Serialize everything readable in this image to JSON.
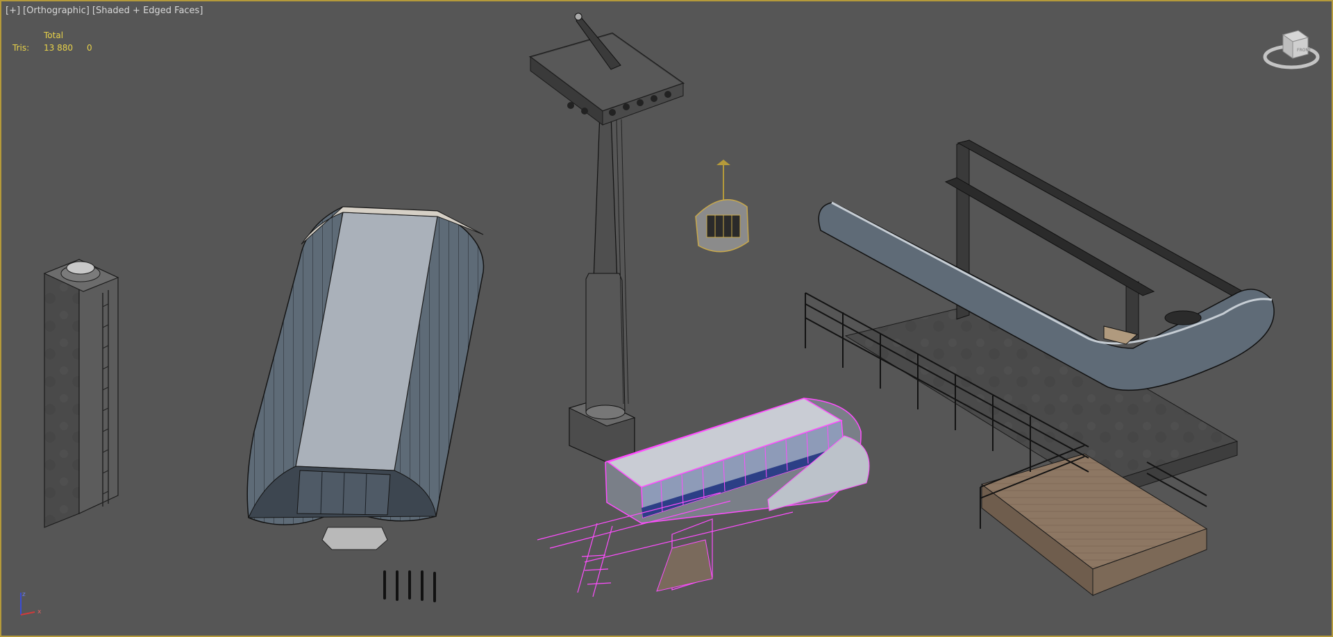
{
  "viewport": {
    "menu": "[+]",
    "view": "[Orthographic]",
    "shading": "[Shaded + Edged Faces]"
  },
  "stats": {
    "header": "Total",
    "tris_label": "Tris:",
    "tris_total": "13 880",
    "tris_selected": "0"
  },
  "viewcube": {
    "face_label": "FRONT"
  },
  "axis": {
    "z": "z",
    "x": "x"
  },
  "colors": {
    "background": "#565656",
    "border": "#b59a3a",
    "stats_text": "#e8d24a",
    "selection_wire": "#ff4dff"
  }
}
